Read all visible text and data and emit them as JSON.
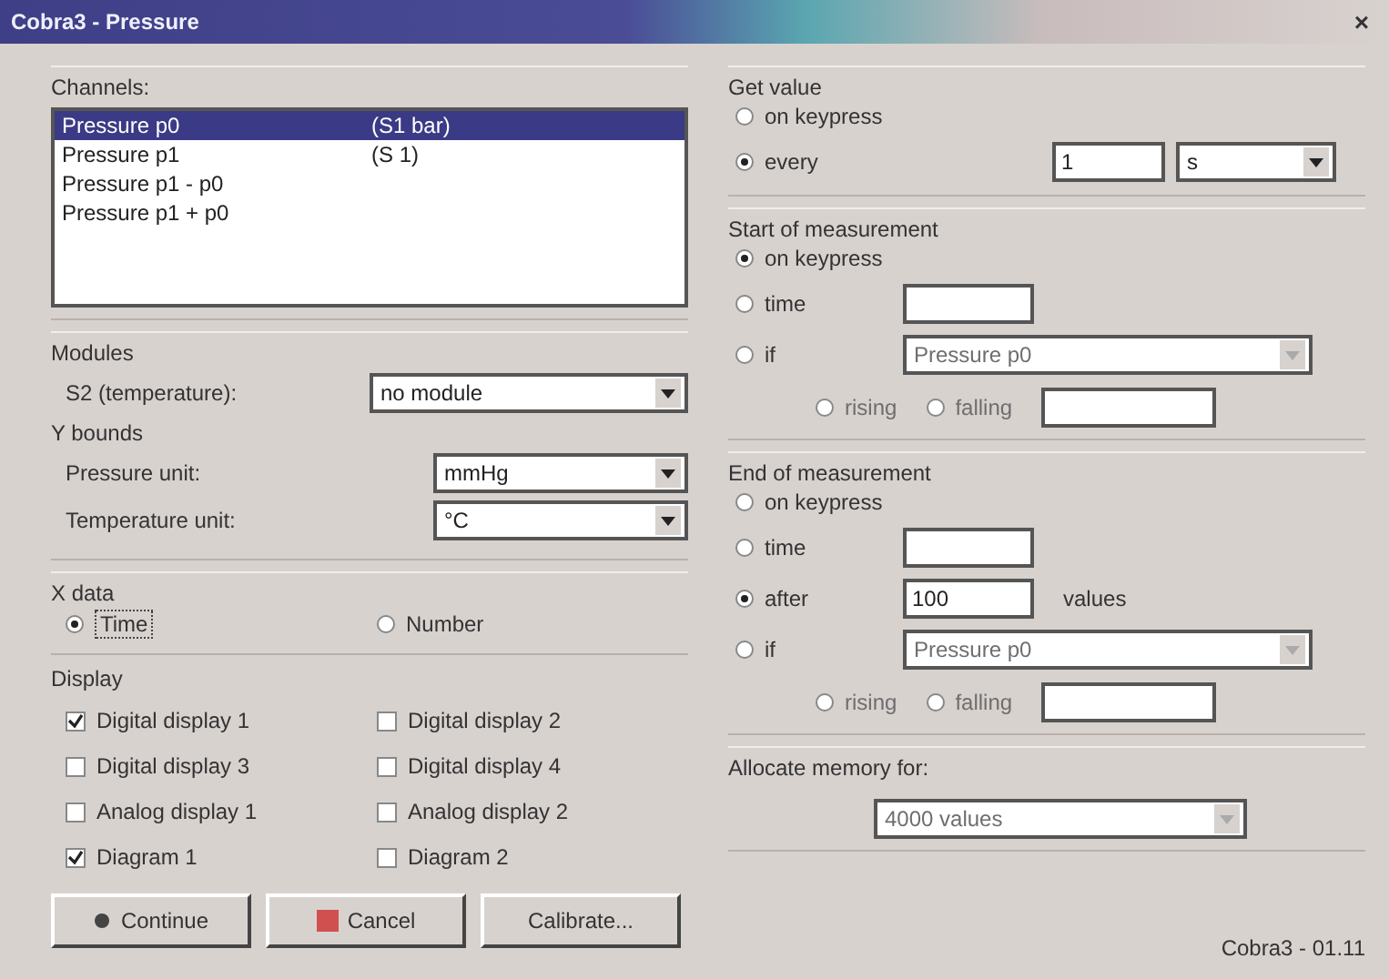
{
  "window": {
    "title": "Cobra3 - Pressure",
    "close": "×"
  },
  "channels": {
    "label": "Channels:",
    "items": [
      {
        "name": "Pressure p0",
        "unit": "(S1 bar)",
        "selected": true
      },
      {
        "name": "Pressure p1",
        "unit": "(S 1)",
        "selected": false
      },
      {
        "name": "Pressure p1 - p0",
        "selected": false
      },
      {
        "name": "Pressure p1 + p0",
        "selected": false
      }
    ]
  },
  "modules": {
    "label": "Modules",
    "fields": [
      {
        "label": "S2 (temperature):",
        "value": "no module"
      }
    ]
  },
  "y_bounds": {
    "label": "Y bounds",
    "fields": [
      {
        "label": "Pressure unit:",
        "value": "mmHg"
      },
      {
        "label": "Temperature unit:",
        "value": "°C"
      }
    ]
  },
  "x_data": {
    "label": "X data",
    "options": [
      {
        "label": "Time",
        "selected": true
      },
      {
        "label": "Number",
        "selected": false
      }
    ]
  },
  "display": {
    "label": "Display",
    "items": [
      {
        "label": "Digital display 1",
        "checked": true
      },
      {
        "label": "Digital display 2",
        "checked": false
      },
      {
        "label": "Digital display 3",
        "checked": false
      },
      {
        "label": "Digital display 4",
        "checked": false
      },
      {
        "label": "Analog display 1",
        "checked": false
      },
      {
        "label": "Analog display 2",
        "checked": false
      },
      {
        "label": "Diagram 1",
        "checked": true
      },
      {
        "label": "Diagram 2",
        "checked": false
      }
    ]
  },
  "buttons": [
    {
      "label": "Continue",
      "kind": "continue"
    },
    {
      "label": "Cancel",
      "kind": "cancel"
    },
    {
      "label": "Calibrate...",
      "kind": "plain"
    }
  ],
  "get_value": {
    "label": "Get value",
    "options": [
      {
        "label": "on keypress",
        "selected": false
      },
      {
        "label": "every",
        "selected": true
      }
    ],
    "interval": "1",
    "unit": "s"
  },
  "start": {
    "label": "Start of measurement",
    "options": [
      {
        "label": "on keypress",
        "selected": true
      },
      {
        "label": "time",
        "selected": false
      },
      {
        "label": "if",
        "selected": false
      }
    ],
    "channel": "Pressure p0",
    "edges_disabled": true,
    "edges": [
      {
        "label": "rising",
        "selected": false
      },
      {
        "label": "falling",
        "selected": false
      }
    ]
  },
  "end": {
    "label": "End of measurement",
    "options": [
      {
        "label": "on keypress",
        "selected": false
      },
      {
        "label": "time",
        "selected": false
      },
      {
        "label": "after",
        "selected": true
      },
      {
        "label": "if",
        "selected": false
      }
    ],
    "count": "100",
    "count_suffix": "values",
    "channel": "Pressure p0",
    "edges_disabled": true,
    "edges": [
      {
        "label": "rising",
        "selected": false
      },
      {
        "label": "falling",
        "selected": false
      }
    ]
  },
  "memory": {
    "label": "Allocate memory for:",
    "value": "4000 values",
    "disabled": true
  },
  "version": "Cobra3 - 01.11"
}
